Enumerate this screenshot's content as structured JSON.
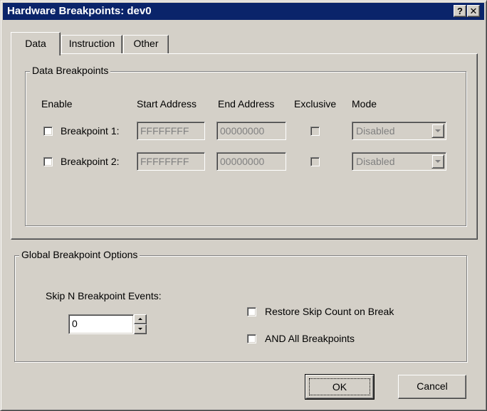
{
  "window": {
    "title": "Hardware Breakpoints: dev0",
    "help_glyph": "?",
    "close_glyph": "✕"
  },
  "tabs": [
    {
      "label": "Data",
      "active": true
    },
    {
      "label": "Instruction",
      "active": false
    },
    {
      "label": "Other",
      "active": false
    }
  ],
  "data_breakpoints": {
    "group_label": "Data Breakpoints",
    "headers": {
      "enable": "Enable",
      "start_address": "Start Address",
      "end_address": "End Address",
      "exclusive": "Exclusive",
      "mode": "Mode"
    },
    "rows": [
      {
        "label": "Breakpoint 1:",
        "start": "FFFFFFFF",
        "end": "00000000",
        "mode": "Disabled",
        "enabled": false,
        "exclusive": false
      },
      {
        "label": "Breakpoint 2:",
        "start": "FFFFFFFF",
        "end": "00000000",
        "mode": "Disabled",
        "enabled": false,
        "exclusive": false
      }
    ]
  },
  "global_options": {
    "group_label": "Global Breakpoint Options",
    "skip_label": "Skip N Breakpoint Events:",
    "skip_value": "0",
    "restore_skip_label": "Restore Skip Count on Break",
    "and_all_label": "AND All Breakpoints"
  },
  "buttons": {
    "ok": "OK",
    "cancel": "Cancel"
  }
}
